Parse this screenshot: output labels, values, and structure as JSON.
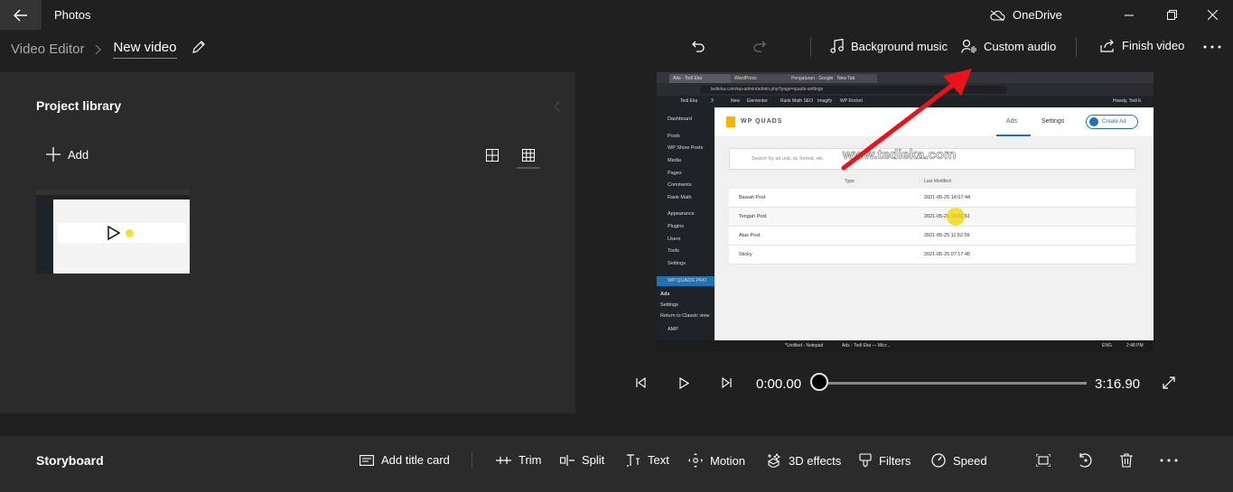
{
  "app": {
    "title": "Photos",
    "cloud_label": "OneDrive"
  },
  "breadcrumb": {
    "parent": "Video Editor",
    "current": "New video"
  },
  "toolbar": {
    "background_music": "Background music",
    "custom_audio": "Custom audio",
    "finish_video": "Finish video"
  },
  "library": {
    "title": "Project library",
    "add_label": "Add"
  },
  "playback": {
    "current_time": "0:00.00",
    "duration": "3:16.90",
    "progress": 0
  },
  "storyboard": {
    "title": "Storyboard",
    "tools": {
      "add_title_card": "Add title card",
      "trim": "Trim",
      "split": "Split",
      "text": "Text",
      "motion": "Motion",
      "effects_3d": "3D effects",
      "filters": "Filters",
      "speed": "Speed"
    }
  },
  "preview": {
    "tabs": [
      "Ads - Tedi Eka",
      "WordPress",
      "Pengaturan - Google AdSense",
      "New Tab"
    ],
    "url": "tedieka.com/wp-admin/admin.php?page=quads-settings",
    "admin_bar": [
      "Tedi Eka",
      "3",
      "New",
      "Elementor",
      "Rank Math SEO",
      "Imagify",
      "WP Rocket"
    ],
    "howdy": "Howdy, Tedi E",
    "sidebar": [
      "Dashboard",
      "Posts",
      "WP Show Posts",
      "Media",
      "Pages",
      "Comments",
      "Rank Math",
      "Appearance",
      "Plugins",
      "Users",
      "Tools",
      "Settings"
    ],
    "sidebar_active": "WP QUADS PRO",
    "sidebar_sub": [
      "Ads",
      "Settings",
      "Return to Classic view"
    ],
    "sidebar_extra": "AMP",
    "plugin_name": "WP QUADS",
    "nav": {
      "ads": "Ads",
      "settings": "Settings",
      "create": "Create Ad"
    },
    "search_placeholder": "Search by ad unit, id, format, etc",
    "columns": [
      "Type",
      "Last Modified"
    ],
    "rows": [
      {
        "name": "Bawah Post",
        "date": "2021-05-25 14:57:44"
      },
      {
        "name": "Tengah Post",
        "date": "2021-05-25 14:55:51"
      },
      {
        "name": "Atas Post",
        "date": "2021-05-25 11:52:56"
      },
      {
        "name": "Sticky",
        "date": "2021-05-25 07:17:45"
      }
    ],
    "watermark": "www.tedieka.com",
    "taskbar_items": [
      "*Untitled - Notepad",
      "Ads - Tedi Eka — Micr..."
    ],
    "taskbar_lang": "ENG",
    "taskbar_time": "2:48 PM"
  },
  "colors": {
    "background": "#202020",
    "panel": "#2b2b2b",
    "arrow": "#e8141a"
  }
}
